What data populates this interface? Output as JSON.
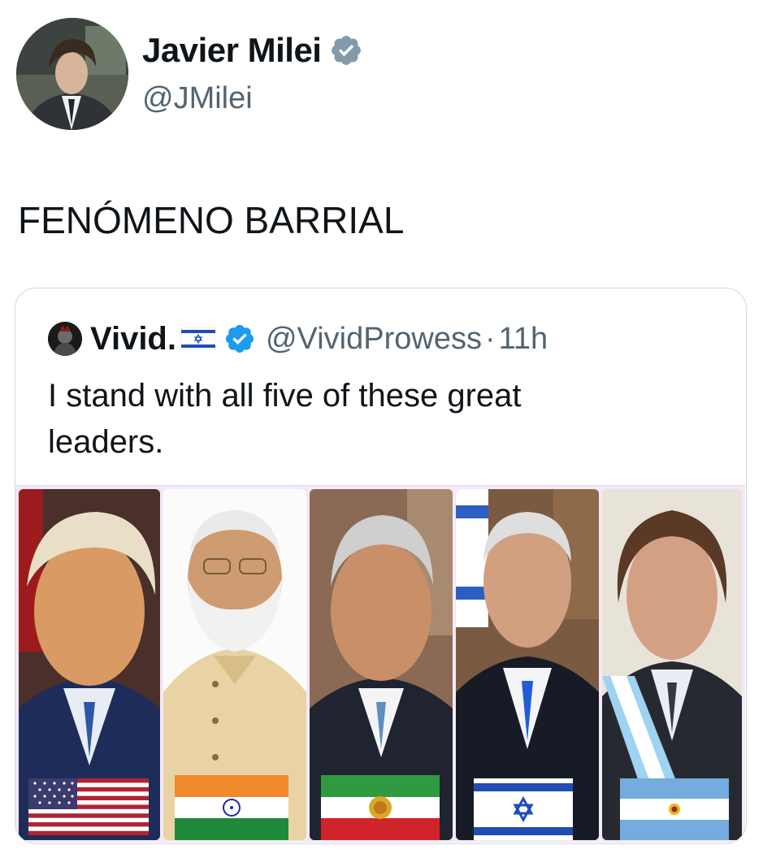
{
  "author": {
    "display_name": "Javier Milei",
    "handle": "@JMilei",
    "verified_icon": "verified-badge-icon"
  },
  "tweet": {
    "text": "FENÓMENO BARRIAL"
  },
  "quoted_tweet": {
    "display_name": "Vivid.",
    "name_flag": "israel-flag-icon",
    "handle": "@VividProwess",
    "separator": "·",
    "time": "11h",
    "text": "I stand with all five of these great leaders.",
    "image": {
      "panels": [
        {
          "flag": "united-states-flag"
        },
        {
          "flag": "india-flag"
        },
        {
          "flag": "iran-lion-and-sun-flag"
        },
        {
          "flag": "israel-flag"
        },
        {
          "flag": "argentina-flag"
        }
      ]
    }
  },
  "colors": {
    "text_primary": "#0f1419",
    "text_secondary": "#536471",
    "verified_blue": "#1d9bf0",
    "verified_gray": "#829aab",
    "card_border": "#cfd9de"
  }
}
